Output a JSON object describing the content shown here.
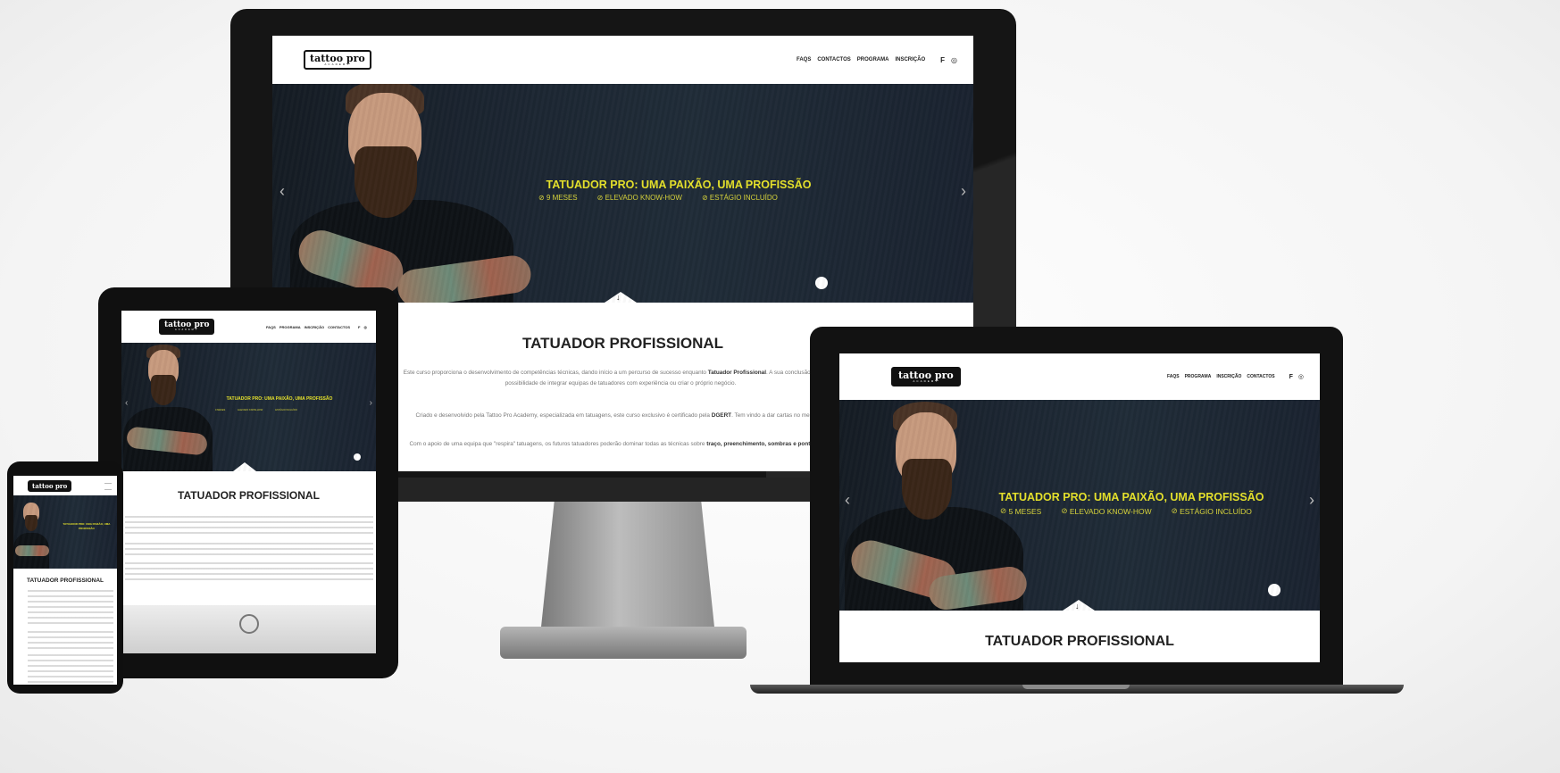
{
  "site": {
    "logo_text": "tattoo pro",
    "logo_sub": "ACADEMY",
    "nav_desktop": [
      "FAQS",
      "CONTACTOS",
      "PROGRAMA",
      "INSCRIÇÃO"
    ],
    "nav_tablet": [
      "FAQS",
      "PROGRAMA",
      "INSCRIÇÃO",
      "CONTACTOS"
    ],
    "nav_laptop": [
      "FAQS",
      "PROGRAMA",
      "INSCRIÇÃO",
      "CONTACTOS"
    ],
    "social_facebook": "f",
    "social_instagram": "◎",
    "hero_title": "TATUADOR PRO: UMA PAIXÃO, UMA PROFISSÃO",
    "hero_features_desktop": [
      "9 MESES",
      "ELEVADO KNOW-HOW",
      "ESTÁGIO INCLUÍDO"
    ],
    "hero_features_laptop": [
      "5 MESES",
      "ELEVADO KNOW-HOW",
      "ESTÁGIO INCLUÍDO"
    ],
    "section_title": "TATUADOR PROFISSIONAL",
    "para1_a": "Este curso proporciona o desenvolvimento de competências técnicas, dando início a um percurso de sucesso enquanto ",
    "para1_b": "Tatuador Profissional",
    "para1_c": ". A sua conclusão, garante a possibilidade de integrar equipas de tatuadores com experiência ou criar o próprio negócio.",
    "para2_a": "Criado e desenvolvido pela Tattoo Pro Academy, especializada em tatuagens, este curso exclusivo é certificado pela ",
    "para2_b": "DGERT",
    "para2_c": ". Tem vindo a dar cartas no mercado.",
    "para3_a": "Com o apoio de uma equipa que \"respira\" tatuagens, os futuros tatuadores poderão dominar todas as técnicas sobre ",
    "para3_b": "traço, preenchimento, sombras e pontilhismo",
    "para3_c": ".",
    "scroll_icon": "↓",
    "prev_icon": "‹",
    "next_icon": "›",
    "mobile_hero_title": "TATUADOR PRO: UMA PAIXÃO, UMA PROFISSÃO"
  }
}
